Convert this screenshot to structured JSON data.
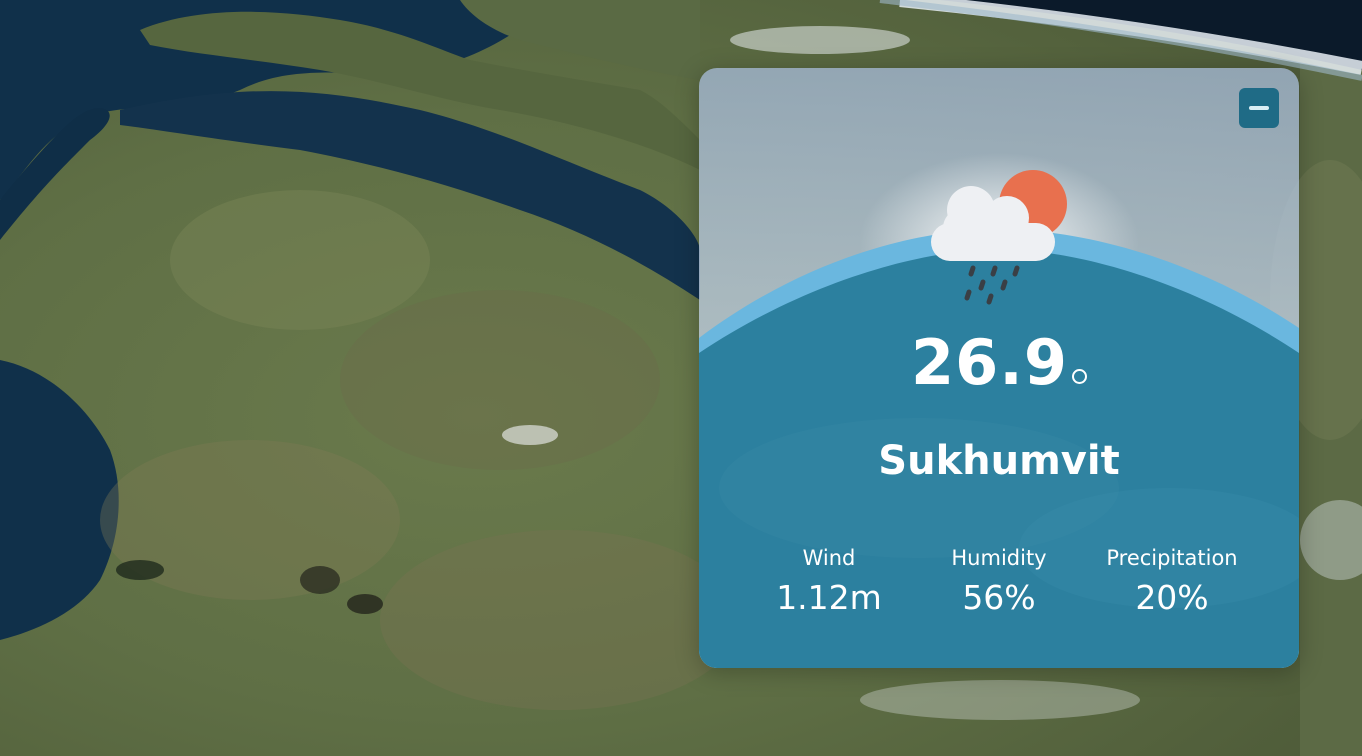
{
  "weather": {
    "temperature": "26.9",
    "location": "Sukhumvit",
    "condition_icon": "sun-cloud-rain-icon",
    "stats": {
      "wind": {
        "label": "Wind",
        "value": "1.12m"
      },
      "humidity": {
        "label": "Humidity",
        "value": "56%"
      },
      "precipitation": {
        "label": "Precipitation",
        "value": "20%"
      }
    },
    "minimize_icon": "minus-icon"
  },
  "colors": {
    "card_blue": "#2a7e9c",
    "arc_light_blue": "#6ab7df",
    "sun": "#e8704e",
    "button": "#1f6b86"
  }
}
